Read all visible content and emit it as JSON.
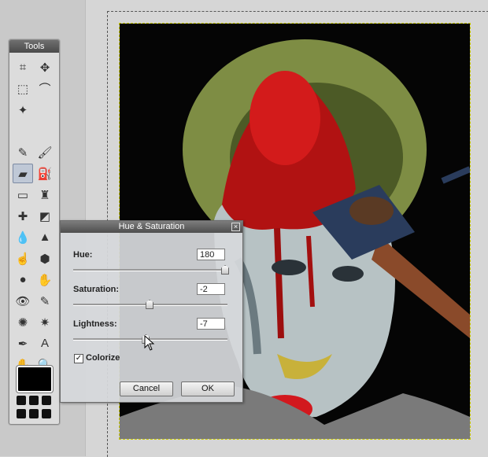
{
  "tools_panel": {
    "title": "Tools",
    "tools": [
      {
        "icon": "crop-icon",
        "glyph": "⌗"
      },
      {
        "icon": "move-icon",
        "glyph": "✥"
      },
      {
        "icon": "marquee-select-icon",
        "glyph": "⬚"
      },
      {
        "icon": "lasso-icon",
        "glyph": "⌒"
      },
      {
        "icon": "magic-wand-icon",
        "glyph": "✦"
      },
      {
        "icon": "empty-slot",
        "glyph": ""
      },
      {
        "icon": "pencil-icon",
        "glyph": "✎"
      },
      {
        "icon": "brush-icon",
        "glyph": "🖌"
      },
      {
        "icon": "eraser-icon",
        "glyph": "▰",
        "active": true
      },
      {
        "icon": "paint-bucket-icon",
        "glyph": "⛽"
      },
      {
        "icon": "gradient-icon",
        "glyph": "▭"
      },
      {
        "icon": "clone-stamp-icon",
        "glyph": "♜"
      },
      {
        "icon": "healing-icon",
        "glyph": "✚"
      },
      {
        "icon": "shape-icon",
        "glyph": "◩"
      },
      {
        "icon": "blur-drop-icon",
        "glyph": "💧"
      },
      {
        "icon": "sharpen-icon",
        "glyph": "▲"
      },
      {
        "icon": "smudge-icon",
        "glyph": "☝"
      },
      {
        "icon": "sponge-icon",
        "glyph": "⬢"
      },
      {
        "icon": "dodge-icon",
        "glyph": "●"
      },
      {
        "icon": "burn-icon",
        "glyph": "✋"
      },
      {
        "icon": "red-eye-icon",
        "glyph": "👁"
      },
      {
        "icon": "spot-heal-icon",
        "glyph": "✎"
      },
      {
        "icon": "bloat-icon",
        "glyph": "✺"
      },
      {
        "icon": "pinch-icon",
        "glyph": "✷"
      },
      {
        "icon": "eyedropper-icon",
        "glyph": "✒"
      },
      {
        "icon": "text-icon",
        "glyph": "A"
      },
      {
        "icon": "hand-icon",
        "glyph": "✋"
      },
      {
        "icon": "zoom-icon",
        "glyph": "🔍"
      }
    ]
  },
  "dialog": {
    "title": "Hue & Saturation",
    "close_glyph": "×",
    "hue": {
      "label": "Hue:",
      "value": "180",
      "level": 1.0
    },
    "saturation": {
      "label": "Saturation:",
      "value": "-2",
      "level": 0.49
    },
    "lightness": {
      "label": "Lightness:",
      "value": "-7",
      "level": 0.465
    },
    "colorize": {
      "label": "Colorize",
      "checked": true,
      "glyph": "✓"
    },
    "cancel_label": "Cancel",
    "ok_label": "OK"
  },
  "colors": {
    "foreground": "#000000",
    "hair": "#86944a",
    "blood": "#c01414",
    "skin": "#b9c3c6",
    "hammer_head": "#283a5a",
    "handle": "#8a4a2a"
  }
}
